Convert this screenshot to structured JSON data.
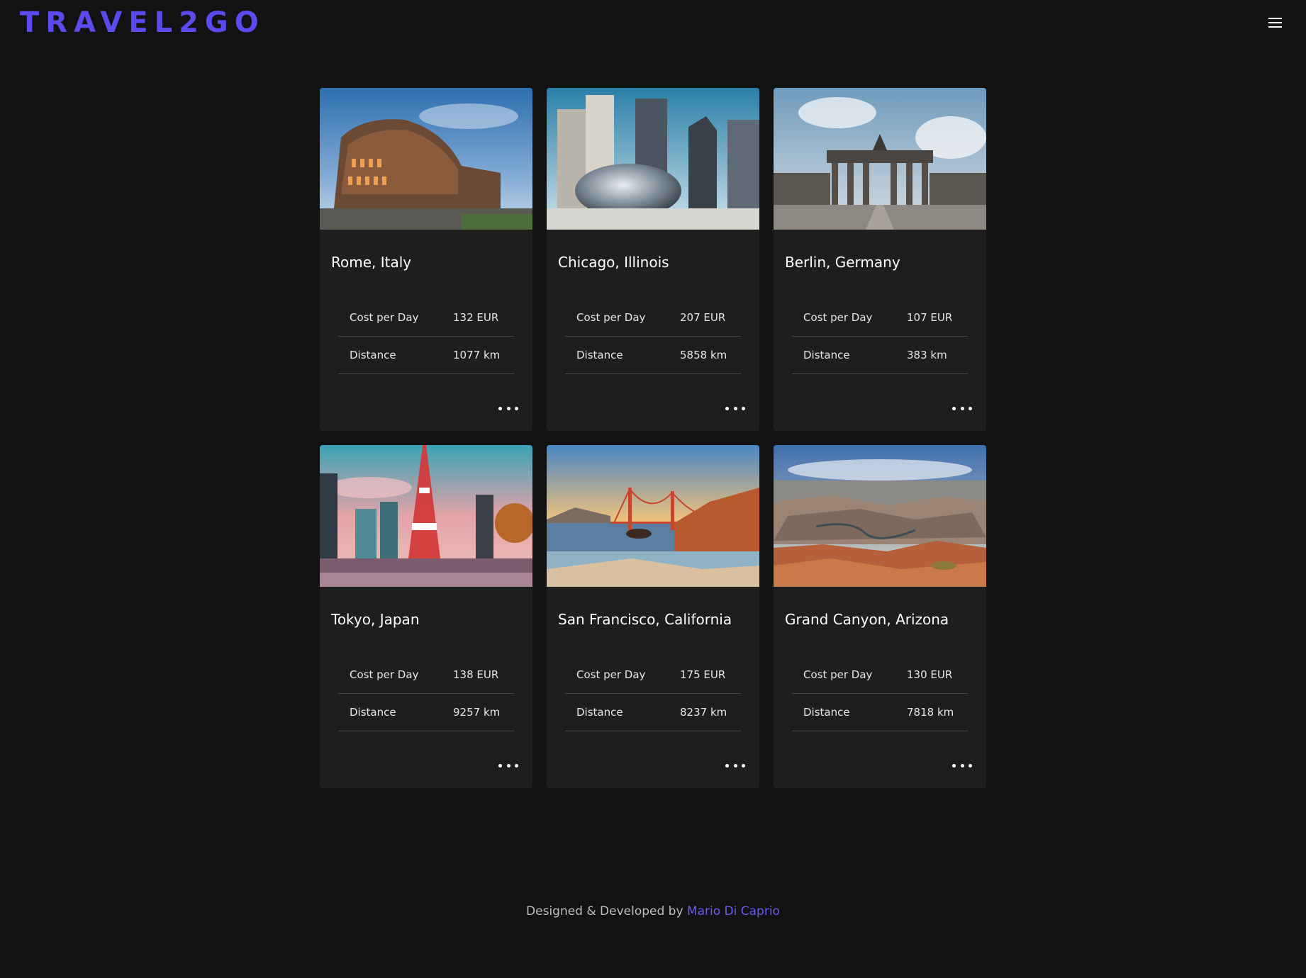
{
  "header": {
    "logo_text": "TRAVEL2GO",
    "menu_icon": "hamburger-menu-icon",
    "brand_color": "#5b4bee"
  },
  "cards": [
    {
      "title": "Rome, Italy",
      "image": "colosseum-photo",
      "cost_label": "Cost per Day",
      "cost_value": "132 EUR",
      "distance_label": "Distance",
      "distance_value": "1077 km"
    },
    {
      "title": "Chicago, Illinois",
      "image": "cloud-gate-bean-photo",
      "cost_label": "Cost per Day",
      "cost_value": "207 EUR",
      "distance_label": "Distance",
      "distance_value": "5858 km"
    },
    {
      "title": "Berlin, Germany",
      "image": "brandenburg-gate-photo",
      "cost_label": "Cost per Day",
      "cost_value": "107 EUR",
      "distance_label": "Distance",
      "distance_value": "383 km"
    },
    {
      "title": "Tokyo, Japan",
      "image": "tokyo-tower-photo",
      "cost_label": "Cost per Day",
      "cost_value": "138 EUR",
      "distance_label": "Distance",
      "distance_value": "9257 km"
    },
    {
      "title": "San Francisco, California",
      "image": "golden-gate-bridge-photo",
      "cost_label": "Cost per Day",
      "cost_value": "175 EUR",
      "distance_label": "Distance",
      "distance_value": "8237 km"
    },
    {
      "title": "Grand Canyon, Arizona",
      "image": "grand-canyon-photo",
      "cost_label": "Cost per Day",
      "cost_value": "130 EUR",
      "distance_label": "Distance",
      "distance_value": "7818 km"
    }
  ],
  "footer": {
    "text": "Designed & Developed by ",
    "author": "Mario Di Caprio",
    "link_color": "#6a5cf0"
  }
}
